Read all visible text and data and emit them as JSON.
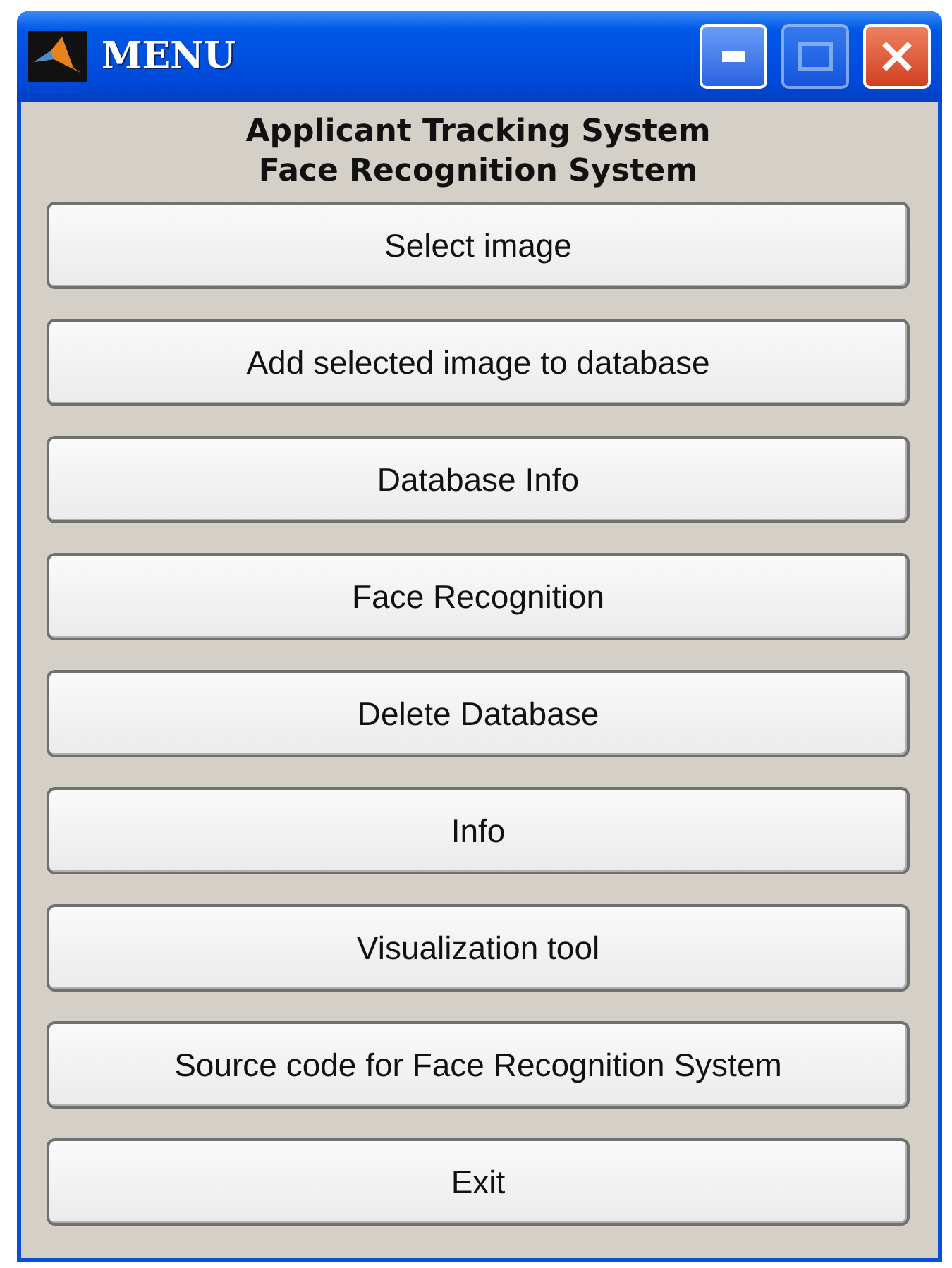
{
  "window": {
    "title": "MENU",
    "controls": [
      {
        "kind": "minimize",
        "disabled": false
      },
      {
        "kind": "maximize",
        "disabled": true
      },
      {
        "kind": "close",
        "disabled": false
      }
    ]
  },
  "heading": [
    "Applicant Tracking System",
    "Face Recognition System"
  ],
  "buttons": [
    "Select image",
    "Add selected image to database",
    "Database Info",
    "Face Recognition",
    "Delete Database",
    "Info",
    "Visualization tool",
    "Source code for Face Recognition System",
    "Exit"
  ]
}
